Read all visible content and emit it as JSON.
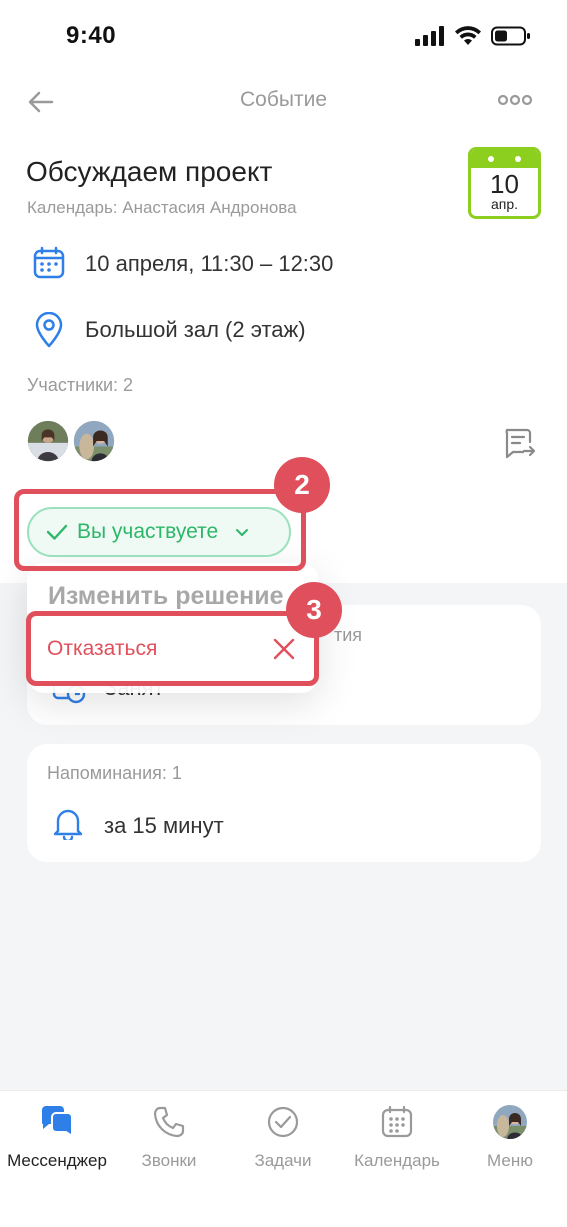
{
  "status_bar": {
    "time": "9:40"
  },
  "header": {
    "title": "Событие"
  },
  "event": {
    "title": "Обсуждаем проект",
    "calendar": "Календарь: Анастасия Андронова",
    "date_badge": {
      "day": "10",
      "month": "апр.",
      "color": "#8ccf1f"
    },
    "datetime": "10 апреля, 11:30 – 12:30",
    "location": "Большой зал (2 этаж)",
    "participants_label": "Участники: 2"
  },
  "rsvp": {
    "status_label": "Вы участвуете",
    "menu_heading": "Изменить решение",
    "decline_label": "Отказаться"
  },
  "availability_card": {
    "label_partial": "тия",
    "value": "Занят"
  },
  "reminders_card": {
    "label": "Напоминания: 1",
    "value": "за 15 минут"
  },
  "annotations": {
    "step_2": "2",
    "step_3": "3",
    "highlight_color": "#e0505c"
  },
  "tabs": [
    {
      "label": "Мессенджер",
      "icon": "chat-bubbles-icon",
      "active": true
    },
    {
      "label": "Звонки",
      "icon": "phone-icon",
      "active": false
    },
    {
      "label": "Задачи",
      "icon": "check-circle-icon",
      "active": false
    },
    {
      "label": "Календарь",
      "icon": "calendar-icon",
      "active": false
    },
    {
      "label": "Меню",
      "icon": "avatar",
      "active": false
    }
  ],
  "colors": {
    "accent_blue": "#2f7fe8",
    "success_green": "#2eb66a",
    "danger_red": "#e0505c"
  }
}
